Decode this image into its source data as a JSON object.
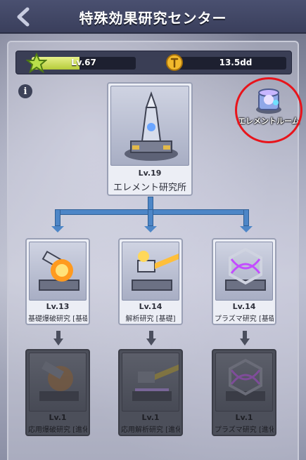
{
  "header": {
    "title": "特殊効果研究センター"
  },
  "stats": {
    "level_label": "Lv.67",
    "level_progress": 0.46,
    "currency_value": "13.5dd"
  },
  "element_room": {
    "label": "エレメントルーム"
  },
  "main_building": {
    "level": "Lv.19",
    "name": "エレメント研究所"
  },
  "tier1": [
    {
      "level": "Lv.13",
      "name": "基礎爆破研究 [基礎]"
    },
    {
      "level": "Lv.14",
      "name": "解析研究 [基礎]"
    },
    {
      "level": "Lv.14",
      "name": "プラズマ研究 [基礎]"
    }
  ],
  "tier2": [
    {
      "level": "Lv.1",
      "name": "応用爆破研究 [進化]"
    },
    {
      "level": "Lv.1",
      "name": "応用解析研究 [進化]"
    },
    {
      "level": "Lv.1",
      "name": "プラズマ研究 [進化]"
    }
  ],
  "icons": {
    "back": "chevron-left-icon",
    "star": "star-icon",
    "coin": "coin-icon",
    "info": "info-icon"
  },
  "colors": {
    "header_bg": "#3a3f5c",
    "connector": "#4d86c7",
    "highlight_ring": "#e8141b",
    "level_fill": "#b5cc3a"
  }
}
